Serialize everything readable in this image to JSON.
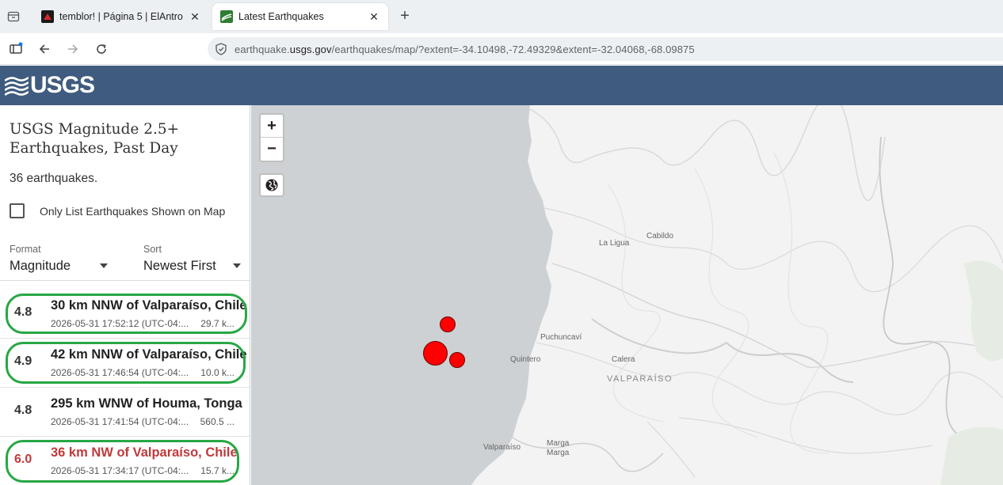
{
  "browser": {
    "tabs": [
      {
        "title": "temblor! | Página 5 | ElAntro",
        "active": false
      },
      {
        "title": "Latest Earthquakes",
        "active": true
      }
    ],
    "url_prefix": "earthquake.",
    "url_domain": "usgs.gov",
    "url_path": "/earthquakes/map/?extent=-34.10498,-72.49329&extent=-32.04068,-68.09875"
  },
  "header": {
    "logo_text": "USGS"
  },
  "sidebar": {
    "title": "USGS Magnitude 2.5+ Earthquakes, Past Day",
    "count": "36 earthquakes.",
    "only_list_label": "Only List Earthquakes Shown on Map",
    "format": {
      "label": "Format",
      "value": "Magnitude"
    },
    "sort": {
      "label": "Sort",
      "value": "Newest First"
    },
    "earthquakes": [
      {
        "mag": "4.8",
        "place": "30 km NNW of Valparaíso, Chile",
        "time": "2026-05-31 17:52:12 (UTC-04:...",
        "depth": "29.7 k...",
        "highlighted": true,
        "big": false
      },
      {
        "mag": "4.9",
        "place": "42 km NNW of Valparaíso, Chile",
        "time": "2026-05-31 17:46:54 (UTC-04:...",
        "depth": "10.0 k...",
        "highlighted": true,
        "big": false
      },
      {
        "mag": "4.8",
        "place": "295 km WNW of Houma, Tonga",
        "time": "2026-05-31 17:41:54 (UTC-04:...",
        "depth": "560.5 ...",
        "highlighted": false,
        "big": false
      },
      {
        "mag": "6.0",
        "place": "36 km NW of Valparaíso, Chile",
        "time": "2026-05-31 17:34:17 (UTC-04:...",
        "depth": "15.7 k...",
        "highlighted": true,
        "big": true
      }
    ]
  },
  "map": {
    "zoom_in": "+",
    "zoom_out": "−",
    "labels": {
      "la_ligua": "La Ligua",
      "cabildo": "Cabildo",
      "puchuncavi": "Puchuncaví",
      "quintero": "Quintero",
      "calera": "Calera",
      "region": "VALPARAÍSO",
      "marga1": "Marga",
      "marga2": "Marga",
      "valparaiso": "Valparaíso"
    },
    "colors": {
      "ocean": "#cdd1d3",
      "land": "#f3f3f3",
      "quake": "#ff0000",
      "highlight_ring": "#27a745",
      "header": "#3f5b7f"
    }
  }
}
